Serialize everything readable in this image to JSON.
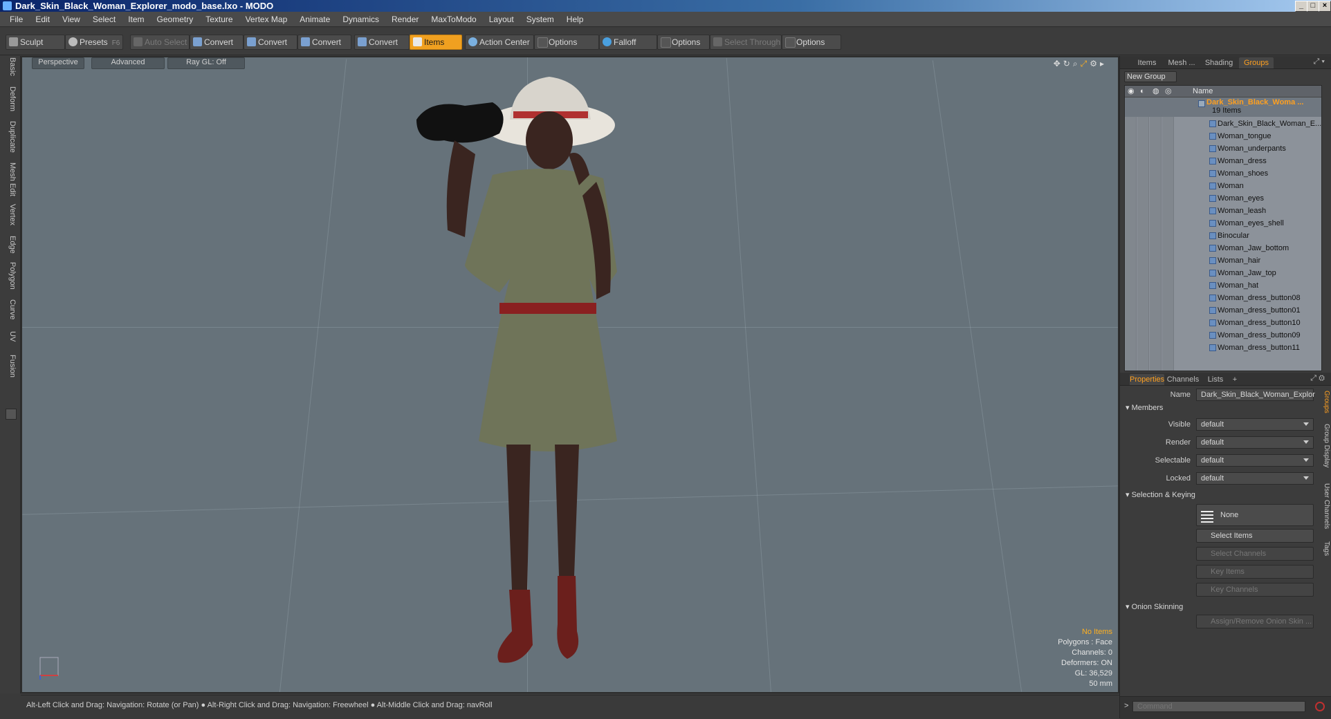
{
  "window": {
    "title": "Dark_Skin_Black_Woman_Explorer_modo_base.lxo - MODO"
  },
  "menu": [
    "File",
    "Edit",
    "View",
    "Select",
    "Item",
    "Geometry",
    "Texture",
    "Vertex Map",
    "Animate",
    "Dynamics",
    "Render",
    "MaxToModo",
    "Layout",
    "System",
    "Help"
  ],
  "toolbar": {
    "sculpt": "Sculpt",
    "presets": "Presets",
    "presets_key": "F6",
    "auto_select": "Auto Select",
    "convert1": "Convert",
    "convert2": "Convert",
    "convert3": "Convert",
    "convert4": "Convert",
    "items": "Items",
    "action_center": "Action Center",
    "options1": "Options",
    "falloff": "Falloff",
    "options2": "Options",
    "select_through": "Select Through",
    "options3": "Options"
  },
  "left_tabs": [
    "Basic",
    "Deform",
    "Duplicate",
    "Mesh Edit",
    "Vertex",
    "Edge",
    "Polygon",
    "Curve",
    "UV",
    "Fusion"
  ],
  "viewport": {
    "view": "Perspective",
    "shading": "Advanced",
    "raygl": "Ray GL: Off",
    "hud": {
      "selection": "No Items",
      "polygons": "Polygons : Face",
      "channels": "Channels: 0",
      "deformers": "Deformers: ON",
      "gl": "GL: 36,529",
      "lens": "50 mm"
    }
  },
  "status": "Alt-Left Click and Drag: Navigation: Rotate (or Pan) ● Alt-Right Click and Drag: Navigation: Freewheel ● Alt-Middle Click and Drag: navRoll",
  "panel_top": {
    "tabs": [
      "Items",
      "Mesh ...",
      "Shading",
      "Groups"
    ],
    "new_group": "New Group",
    "col_name": "Name",
    "group_name": "Dark_Skin_Black_Woma ...",
    "group_count": "19 Items",
    "items": [
      "Dark_Skin_Black_Woman_E...",
      "Woman_tongue",
      "Woman_underpants",
      "Woman_dress",
      "Woman_shoes",
      "Woman",
      "Woman_eyes",
      "Woman_leash",
      "Woman_eyes_shell",
      "Binocular",
      "Woman_Jaw_bottom",
      "Woman_hair",
      "Woman_Jaw_top",
      "Woman_hat",
      "Woman_dress_button08",
      "Woman_dress_button01",
      "Woman_dress_button10",
      "Woman_dress_button09",
      "Woman_dress_button11"
    ]
  },
  "panel_props": {
    "tabs": [
      "Properties",
      "Channels",
      "Lists",
      "+"
    ],
    "name_label": "Name",
    "name_value": "Dark_Skin_Black_Woman_Explor",
    "members": "Members",
    "visible_label": "Visible",
    "visible_value": "default",
    "render_label": "Render",
    "render_value": "default",
    "selectable_label": "Selectable",
    "selectable_value": "default",
    "locked_label": "Locked",
    "locked_value": "default",
    "selection_keying": "Selection & Keying",
    "none": "None",
    "select_items": "Select Items",
    "select_channels": "Select Channels",
    "key_items": "Key Items",
    "key_channels": "Key Channels",
    "onion": "Onion Skinning",
    "assign_onion": "Assign/Remove Onion Skin ...",
    "side_tabs": [
      "Groups",
      "Group Display",
      "User Channels",
      "Tags"
    ]
  },
  "command": {
    "placeholder": "Command",
    "prompt": ">"
  },
  "colors": {
    "accent": "#ffa020",
    "viewport_bg": "#66727a"
  }
}
